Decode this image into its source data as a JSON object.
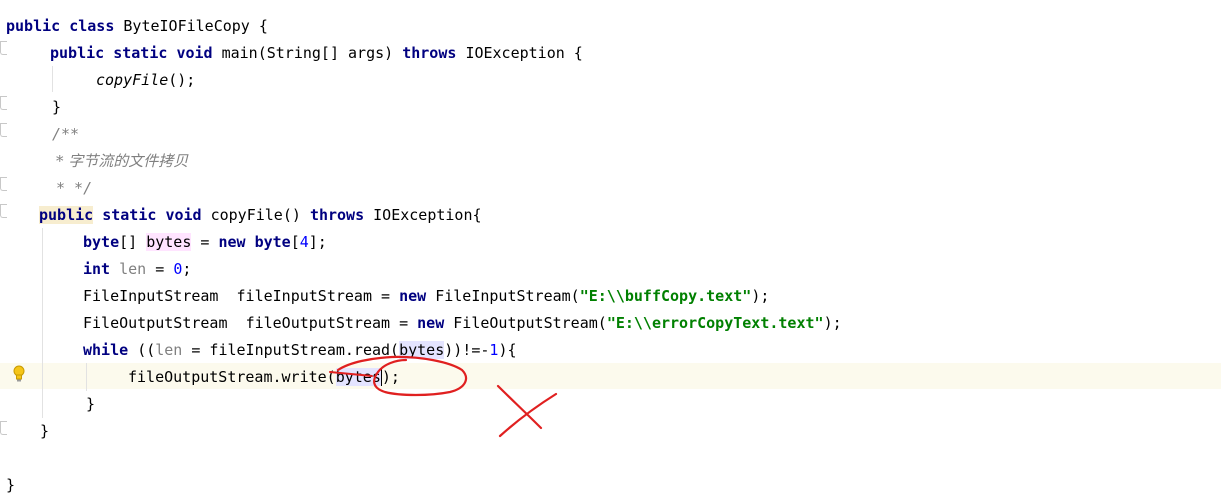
{
  "code": {
    "line1": {
      "kw_public": "public",
      "kw_class": "class",
      "class_name": "ByteIOFileCopy",
      "brace": "{"
    },
    "line2": {
      "kw_public": "public",
      "kw_static": "static",
      "kw_void": "void",
      "signature": "main(String[] args)",
      "kw_throws": "throws",
      "exception": "IOException {"
    },
    "line3": {
      "call": "copyFile",
      "rest": "();"
    },
    "line4": {
      "brace": "}"
    },
    "line5": {
      "comment": "/**"
    },
    "line6": {
      "comment": "* 字节流的文件拷贝"
    },
    "line7": {
      "comment": "* */"
    },
    "line8": {
      "kw_public": "public",
      "kw_static": "static",
      "kw_void": "void",
      "signature": "copyFile()",
      "kw_throws": "throws",
      "exception": "IOException{"
    },
    "line9": {
      "kw_byte": "byte",
      "brackets": "[]",
      "var": "bytes",
      "assign": "=",
      "kw_new": "new",
      "kw_byte2": "byte",
      "open": "[",
      "num": "4",
      "close": "];"
    },
    "line10": {
      "kw_int": "int",
      "var": "len",
      "assign": "=",
      "num": "0",
      "semi": ";"
    },
    "line11": {
      "type": "FileInputStream",
      "var": "fileInputStream =",
      "kw_new": "new",
      "ctor": "FileInputStream(",
      "str": "\"E:\\\\buffCopy.text\"",
      "end": ");"
    },
    "line12": {
      "type": "FileOutputStream",
      "var": "fileOutputStream =",
      "kw_new": "new",
      "ctor": "FileOutputStream(",
      "str": "\"E:\\\\errorCopyText.text\"",
      "end": ");"
    },
    "line13": {
      "kw_while": "while",
      "open": "((",
      "len": "len",
      "mid": "= fileInputStream.read(",
      "arg": "bytes",
      "cmp": "))!=-",
      "num": "1",
      "end": "){"
    },
    "line14": {
      "call": "fileOutputStream.write(",
      "arg_a": "bytes",
      "end": ");"
    },
    "line15": {
      "brace": "}"
    },
    "line16": {
      "brace": "}"
    },
    "line17": {
      "brace": "}"
    }
  },
  "colors": {
    "keyword": "#000080",
    "string": "#008000",
    "number": "#0000ff",
    "comment": "#808080",
    "current_line": "#fcfaed",
    "annotation_ink": "#e02020"
  },
  "icons": {
    "intention": "lightbulb-icon",
    "fold_markers": "fold-marker-icon"
  }
}
